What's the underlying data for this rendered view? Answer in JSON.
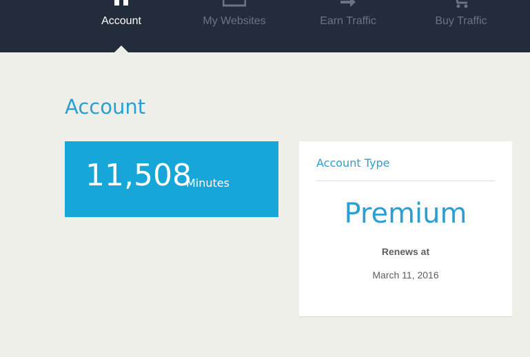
{
  "nav": {
    "items": [
      {
        "label": "Account",
        "icon": "home-icon",
        "active": true
      },
      {
        "label": "My Websites",
        "icon": "browser-window-icon",
        "active": false
      },
      {
        "label": "Earn Traffic",
        "icon": "arrow-right-icon",
        "active": false
      },
      {
        "label": "Buy Traffic",
        "icon": "cart-icon",
        "active": false
      }
    ]
  },
  "page": {
    "title": "Account"
  },
  "minutes_card": {
    "value": "11,508",
    "unit": "Minutes"
  },
  "account_type_card": {
    "heading": "Account Type",
    "value": "Premium",
    "renews_label": "Renews at",
    "renews_date": "March 11, 2016"
  },
  "colors": {
    "nav_bg": "#232c3b",
    "accent": "#2a9fd0",
    "minutes_bg": "#16a6d7",
    "page_bg": "#efefea"
  }
}
